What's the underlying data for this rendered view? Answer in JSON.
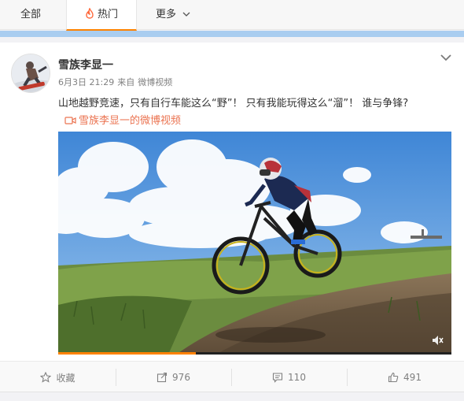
{
  "tabs": {
    "all_label": "全部",
    "hot_label": "热门",
    "more_label": "更多"
  },
  "post": {
    "username": "雪族李显一",
    "date": "6月3日 21:29",
    "source_prefix": "来自",
    "source": "微博视频",
    "text": "山地越野竞速，只有自行车能这么“野”！ 只有我能玩得这么“溜”！ 谁与争锋?",
    "video_link_label": "雪族李显一的微博视频",
    "video_progress": 0.35
  },
  "actions": {
    "favorite_label": "收藏",
    "repost_count": "976",
    "comment_count": "110",
    "like_count": "491"
  },
  "colors": {
    "accent": "#ff8200",
    "link": "#eb7350",
    "strip": "#a9cdf0"
  }
}
